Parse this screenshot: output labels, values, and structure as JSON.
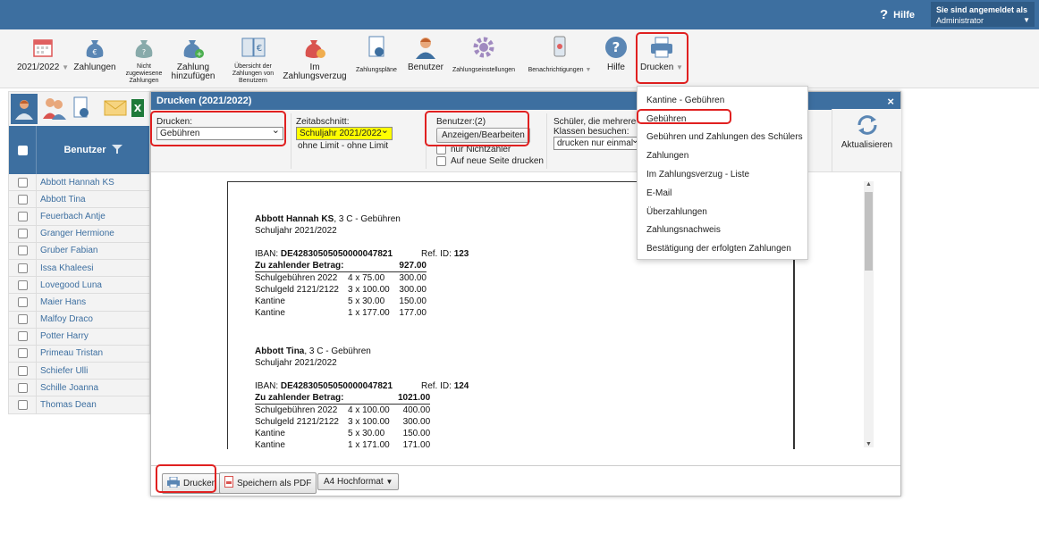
{
  "topbar": {
    "help_label": "Hilfe",
    "logged_in_title": "Sie sind angemeldet als",
    "logged_in_user": "Administrator"
  },
  "toolbar": {
    "year": "2021/2022",
    "zahlungen": "Zahlungen",
    "nicht_zugewiesen": "Nicht zugewiesene Zahlungen",
    "zahlung_hinzufuegen_1": "Zahlung",
    "zahlung_hinzufuegen_2": "hinzufügen",
    "uebersicht": "Übersicht der Zahlungen von Benutzern",
    "verzug_1": "Im",
    "verzug_2": "Zahlungsverzug",
    "plaene": "Zahlungspläne",
    "benutzer": "Benutzer",
    "einstellungen": "Zahlungseinstellungen",
    "benachrichtigungen": "Benachrichtigungen",
    "hilfe": "Hilfe",
    "drucken": "Drucken"
  },
  "sidebar": {
    "header": "Benutzer",
    "users": [
      "Abbott Hannah KS",
      "Abbott Tina",
      "Feuerbach Antje",
      "Granger Hermione",
      "Gruber Fabian",
      "Issa Khaleesi",
      "Lovegood Luna",
      "Maier Hans",
      "Malfoy Draco",
      "Potter Harry",
      "Primeau Tristan",
      "Schiefer Ulli",
      "Schille Joanna",
      "Thomas Dean"
    ]
  },
  "dialog": {
    "title": "Drucken (2021/2022)",
    "close": "×",
    "drucken_label": "Drucken:",
    "drucken_value": "Gebühren",
    "zeitabschnitt_label": "Zeitabschnitt:",
    "zeitabschnitt_value": "Schuljahr 2021/2022",
    "ohne_limit": "ohne Limit  -  ohne Limit",
    "benutzer_label": "Benutzer:(2)",
    "anzeigen_button": "Anzeigen/Bearbeiten",
    "nur_nichtzahler": "nur Nichtzahler",
    "neue_seite": "Auf neue Seite drucken",
    "schueler_label_1": "Schüler, die mehrere",
    "schueler_label_2": "Klassen besuchen:",
    "schueler_value": "drucken nur einmal",
    "aktualisieren": "Aktualisieren",
    "footer_drucken": "Drucken",
    "footer_pdf": "Speichern als PDF",
    "footer_format": "A4 Hochformat"
  },
  "preview": {
    "blocks": [
      {
        "name": "Abbott Hannah KS",
        "class_info": ", 3 C - Gebühren",
        "year": "Schuljahr 2021/2022",
        "iban_label": "IBAN: ",
        "iban": "DE42830505050000047821",
        "ref_label": "Ref. ID: ",
        "ref": "123",
        "amount_label": "Zu zahlender Betrag:",
        "amount": "927.00",
        "lines": [
          [
            "Schulgebühren 2022",
            "4 x 75.00",
            "300.00"
          ],
          [
            "Schulgeld 2121/2122",
            "3 x 100.00",
            "300.00"
          ],
          [
            "Kantine",
            "5 x 30.00",
            "150.00"
          ],
          [
            "Kantine",
            "1 x 177.00",
            "177.00"
          ]
        ]
      },
      {
        "name": "Abbott Tina",
        "class_info": ", 3 C - Gebühren",
        "year": "Schuljahr 2021/2022",
        "iban_label": "IBAN: ",
        "iban": "DE42830505050000047821",
        "ref_label": "Ref. ID: ",
        "ref": "124",
        "amount_label": "Zu zahlender Betrag:",
        "amount": "1021.00",
        "lines": [
          [
            "Schulgebühren 2022",
            "4 x 100.00",
            "400.00"
          ],
          [
            "Schulgeld 2121/2122",
            "3 x 100.00",
            "300.00"
          ],
          [
            "Kantine",
            "5 x 30.00",
            "150.00"
          ],
          [
            "Kantine",
            "1 x 171.00",
            "171.00"
          ]
        ]
      }
    ]
  },
  "dropdown": {
    "items": [
      "Kantine - Gebühren",
      "Gebühren",
      "Gebühren und Zahlungen des Schülers",
      "Zahlungen",
      "Im Zahlungsverzug - Liste",
      "E-Mail",
      "Überzahlungen",
      "Zahlungsnachweis",
      "Bestätigung der erfolgten Zahlungen"
    ]
  },
  "colors": {
    "primary": "#3d6fa0",
    "highlight_red": "#e02020",
    "select_yellow": "#ffff00"
  }
}
